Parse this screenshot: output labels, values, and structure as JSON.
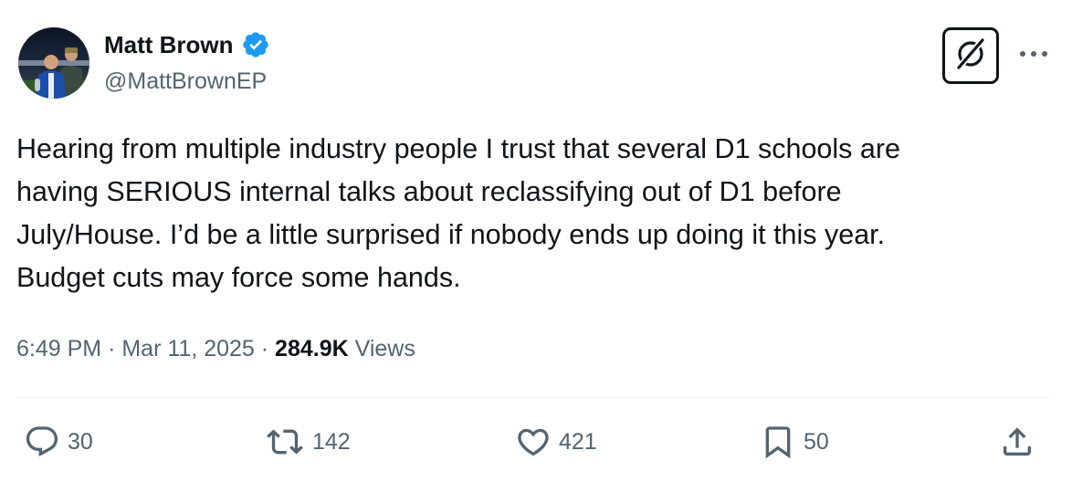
{
  "author": {
    "display_name": "Matt Brown",
    "handle": "@MattBrownEP",
    "verified": true
  },
  "tweet": {
    "text_lines": [
      "Hearing from multiple industry people I trust that several D1 schools are",
      "having SERIOUS internal talks about reclassifying out of D1 before",
      "July/House. I’d be a little surprised if nobody ends up doing it this year.",
      "Budget cuts may force some hands."
    ],
    "time": "6:49 PM",
    "separator": "·",
    "date": "Mar 11, 2025",
    "views_count": "284.9K",
    "views_label": "Views"
  },
  "actions": {
    "replies": "30",
    "reposts": "142",
    "likes": "421",
    "bookmarks": "50"
  },
  "icons": {
    "verified": "verified-badge-icon",
    "grok": "grok-icon",
    "more": "more-dots-icon",
    "reply": "reply-icon",
    "repost": "repost-icon",
    "like": "heart-icon",
    "bookmark": "bookmark-icon",
    "share": "share-icon"
  },
  "colors": {
    "text_primary": "#0f1419",
    "text_secondary": "#536471",
    "verified_blue": "#1d9bf0",
    "divider": "#eff3f4"
  }
}
